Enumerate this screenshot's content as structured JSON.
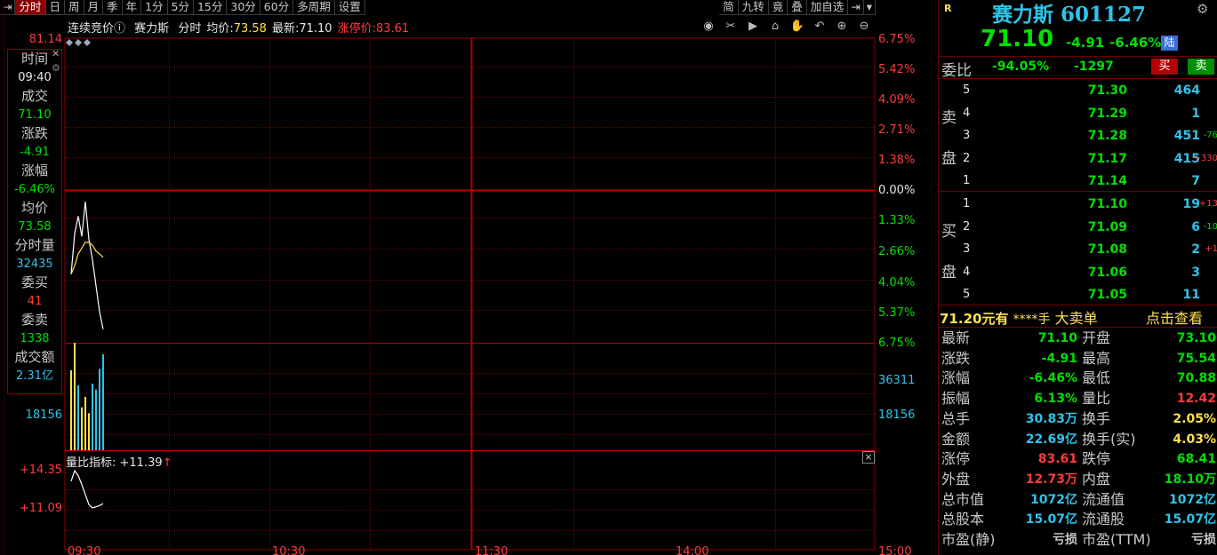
{
  "toolbar": {
    "pin_icon": "pin-icon",
    "periods": [
      "分时",
      "日",
      "周",
      "月",
      "季",
      "年",
      "1分",
      "5分",
      "15分",
      "30分",
      "60分",
      "多周期",
      "设置"
    ],
    "right_items": [
      "简",
      "九转",
      "竟",
      "叠",
      "加自选"
    ],
    "right_pin_icon": "pin-icon",
    "dropdown_icon": "triangle-down-icon"
  },
  "chart_header": {
    "mode": "连续竞价",
    "info_icon": "ⓘ",
    "name": "赛力斯",
    "type": "分时",
    "avg_label": "均价:",
    "avg_value": "73.58",
    "latest_label": "最新:",
    "latest_value": "71.10",
    "limit_label": "涨停价:",
    "limit_value": "83.61"
  },
  "chart_tools": [
    "eye-icon",
    "scissors-icon",
    "play-icon",
    "lock-icon",
    "hand-icon",
    "undo-icon",
    "zoom-in-icon",
    "zoom-out-icon"
  ],
  "info_panel": {
    "items": [
      {
        "label": "时间",
        "value": "09:40",
        "color": "#e6e6e6"
      },
      {
        "label": "成交",
        "value": "71.10",
        "color": "#00e000"
      },
      {
        "label": "涨跌",
        "value": "-4.91",
        "color": "#00e000"
      },
      {
        "label": "涨幅",
        "value": "-6.46%",
        "color": "#00e000"
      },
      {
        "label": "均价",
        "value": "73.58",
        "color": "#00e000"
      },
      {
        "label": "分时量",
        "value": "32435",
        "color": "#2ec4ea"
      },
      {
        "label": "委买",
        "value": "41",
        "color": "#ff3b3b"
      },
      {
        "label": "委卖",
        "value": "1338",
        "color": "#00e000"
      },
      {
        "label": "成交额",
        "value": "2.31亿",
        "color": "#2ec4ea"
      }
    ]
  },
  "price_axis": {
    "left_top": "81.14",
    "right": [
      "6.75%",
      "5.42%",
      "4.09%",
      "2.71%",
      "1.38%",
      "0.00%",
      "1.33%",
      "2.66%",
      "4.04%",
      "5.37%",
      "6.75%"
    ]
  },
  "volume_axis": {
    "left": "18156",
    "right_top": "36311",
    "right_mid": "18156"
  },
  "indicator": {
    "label": "量比指标: +11.39",
    "arrow": "↑",
    "left_top": "+14.35",
    "left_mid": "+11.09",
    "close_icon": "close-icon"
  },
  "time_axis": [
    "09:30",
    "10:30",
    "11:30",
    "14:00",
    "15:00"
  ],
  "chart_data": [
    {
      "type": "line",
      "name": "price",
      "series": [
        {
          "values": [
            73.0,
            74.4,
            75.0,
            74.3,
            75.5,
            74.2,
            73.5,
            72.6,
            71.7,
            71.1
          ]
        },
        {
          "values": [
            73.0,
            73.3,
            73.7,
            73.9,
            74.1,
            74.1,
            74.0,
            73.8,
            73.7,
            73.58
          ]
        }
      ],
      "ylim": [
        70.88,
        81.14
      ]
    },
    {
      "type": "bar",
      "name": "volume",
      "values": [
        27000,
        36311,
        22000,
        14500,
        18000,
        12500,
        22500,
        20500,
        27500,
        32435
      ],
      "colors": [
        "yellow",
        "yellow",
        "cyan",
        "yellow",
        "yellow",
        "yellow",
        "cyan",
        "cyan",
        "cyan",
        "cyan"
      ],
      "ylim": [
        0,
        36311
      ]
    },
    {
      "type": "line",
      "name": "volume-ratio",
      "values": [
        13.4,
        14.35,
        13.9,
        13.1,
        12.2,
        11.3,
        11.0,
        11.1,
        11.2,
        11.39
      ],
      "ylim": [
        7.8,
        14.35
      ]
    }
  ],
  "quote": {
    "flag": "R",
    "name": "赛力斯 601127",
    "price": "71.10",
    "change": "-4.91",
    "change_pct": "-6.46%",
    "badge": "陆",
    "gear_icon": "gear-icon"
  },
  "weibi": {
    "label": "委比",
    "pct": "-94.05%",
    "diff": "-1297",
    "buy_btn": "买",
    "sell_btn": "卖"
  },
  "sell_side": {
    "label_top": "卖",
    "label_bottom": "盘",
    "rows": [
      {
        "idx": "5",
        "price": "71.30",
        "vol": "464",
        "chg": ""
      },
      {
        "idx": "4",
        "price": "71.29",
        "vol": "1",
        "chg": ""
      },
      {
        "idx": "3",
        "price": "71.28",
        "vol": "451",
        "chg": "-76"
      },
      {
        "idx": "2",
        "price": "71.17",
        "vol": "415",
        "chg": "+330"
      },
      {
        "idx": "1",
        "price": "71.14",
        "vol": "7",
        "chg": ""
      }
    ]
  },
  "buy_side": {
    "label_top": "买",
    "label_bottom": "盘",
    "rows": [
      {
        "idx": "1",
        "price": "71.10",
        "vol": "19",
        "chg": "+13"
      },
      {
        "idx": "2",
        "price": "71.09",
        "vol": "6",
        "chg": "-10"
      },
      {
        "idx": "3",
        "price": "71.08",
        "vol": "2",
        "chg": "+1"
      },
      {
        "idx": "4",
        "price": "71.06",
        "vol": "3",
        "chg": ""
      },
      {
        "idx": "5",
        "price": "71.05",
        "vol": "11",
        "chg": ""
      }
    ]
  },
  "big_order": {
    "price": "71.20元有",
    "qty": "****手",
    "type": "大卖单",
    "action": "点击查看"
  },
  "stats": [
    {
      "l1": "最新",
      "v1": "71.10",
      "c1": "#00e000",
      "l2": "开盘",
      "v2": "73.10",
      "c2": "#00e000"
    },
    {
      "l1": "涨跌",
      "v1": "-4.91",
      "c1": "#00e000",
      "l2": "最高",
      "v2": "75.54",
      "c2": "#00e000"
    },
    {
      "l1": "涨幅",
      "v1": "-6.46%",
      "c1": "#00e000",
      "l2": "最低",
      "v2": "70.88",
      "c2": "#00e000"
    },
    {
      "l1": "振幅",
      "v1": "6.13%",
      "c1": "#00e000",
      "l2": "量比",
      "v2": "12.42",
      "c2": "#ff3b3b"
    },
    {
      "l1": "总手",
      "v1": "30.83万",
      "c1": "#2ec4ea",
      "l2": "换手",
      "v2": "2.05%",
      "c2": "#ffe14d"
    },
    {
      "l1": "金额",
      "v1": "22.69亿",
      "c1": "#2ec4ea",
      "l2": "换手(实)",
      "v2": "4.03%",
      "c2": "#ffe14d"
    },
    {
      "l1": "涨停",
      "v1": "83.61",
      "c1": "#ff3b3b",
      "l2": "跌停",
      "v2": "68.41",
      "c2": "#00e000"
    },
    {
      "l1": "外盘",
      "v1": "12.73万",
      "c1": "#ff3b3b",
      "l2": "内盘",
      "v2": "18.10万",
      "c2": "#00e000"
    },
    {
      "l1": "总市值",
      "v1": "1072亿",
      "c1": "#2ec4ea",
      "l2": "流通值",
      "v2": "1072亿",
      "c2": "#2ec4ea"
    },
    {
      "l1": "总股本",
      "v1": "15.07亿",
      "c1": "#2ec4ea",
      "l2": "流通股",
      "v2": "15.07亿",
      "c2": "#2ec4ea"
    },
    {
      "l1": "市盈(静)",
      "v1": "亏损",
      "c1": "#c8c8c8",
      "l2": "市盈(TTM)",
      "v2": "亏损",
      "c2": "#c8c8c8"
    }
  ],
  "colors": {
    "up": "#ff3b3b",
    "down": "#00e000",
    "grid": "#8b0000",
    "active_tab": "#8b0000"
  }
}
